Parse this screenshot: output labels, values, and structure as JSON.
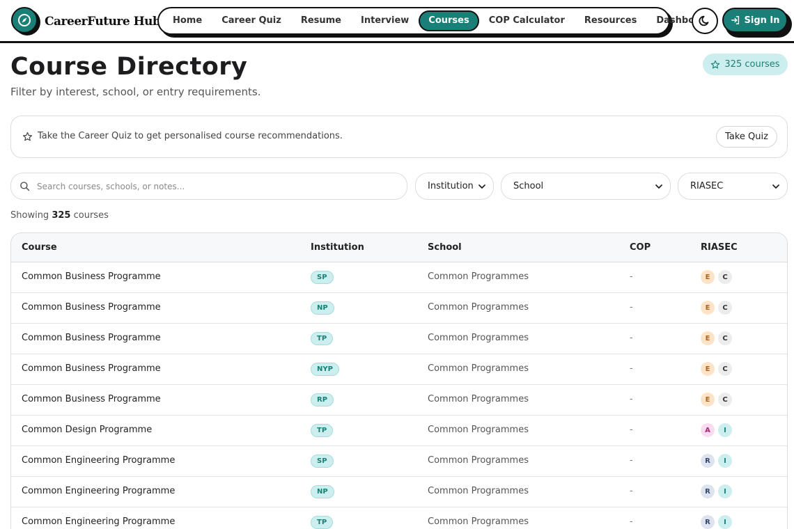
{
  "brand": {
    "name": "CareerFuture Hub"
  },
  "nav": {
    "items": [
      {
        "label": "Home"
      },
      {
        "label": "Career Quiz"
      },
      {
        "label": "Resume"
      },
      {
        "label": "Interview"
      },
      {
        "label": "Courses",
        "active": true
      },
      {
        "label": "COP Calculator"
      },
      {
        "label": "Resources"
      },
      {
        "label": "Dashboard"
      }
    ],
    "sign_in_label": "Sign In"
  },
  "page": {
    "title": "Course Directory",
    "subtitle": "Filter by interest, school, or entry requirements.",
    "course_count_badge": "325 courses"
  },
  "banner": {
    "text": "Take the Career Quiz to get personalised course recommendations.",
    "button_label": "Take Quiz"
  },
  "filters": {
    "search_placeholder": "Search courses, schools, or notes...",
    "institution": "Institution",
    "school": "School",
    "riasec": "RIASEC"
  },
  "results": {
    "showing_prefix": "Showing",
    "count": "325",
    "suffix": "courses"
  },
  "table": {
    "headers": {
      "course": "Course",
      "institution": "Institution",
      "school": "School",
      "cop": "COP",
      "riasec": "RIASEC"
    },
    "rows": [
      {
        "course": "Common Business Programme",
        "institution": "SP",
        "school": "Common Programmes",
        "cop": "-",
        "riasec": [
          "E",
          "C"
        ]
      },
      {
        "course": "Common Business Programme",
        "institution": "NP",
        "school": "Common Programmes",
        "cop": "-",
        "riasec": [
          "E",
          "C"
        ]
      },
      {
        "course": "Common Business Programme",
        "institution": "TP",
        "school": "Common Programmes",
        "cop": "-",
        "riasec": [
          "E",
          "C"
        ]
      },
      {
        "course": "Common Business Programme",
        "institution": "NYP",
        "school": "Common Programmes",
        "cop": "-",
        "riasec": [
          "E",
          "C"
        ]
      },
      {
        "course": "Common Business Programme",
        "institution": "RP",
        "school": "Common Programmes",
        "cop": "-",
        "riasec": [
          "E",
          "C"
        ]
      },
      {
        "course": "Common Design Programme",
        "institution": "TP",
        "school": "Common Programmes",
        "cop": "-",
        "riasec": [
          "A",
          "I"
        ]
      },
      {
        "course": "Common Engineering Programme",
        "institution": "SP",
        "school": "Common Programmes",
        "cop": "-",
        "riasec": [
          "R",
          "I"
        ]
      },
      {
        "course": "Common Engineering Programme",
        "institution": "NP",
        "school": "Common Programmes",
        "cop": "-",
        "riasec": [
          "R",
          "I"
        ]
      },
      {
        "course": "Common Engineering Programme",
        "institution": "TP",
        "school": "Common Programmes",
        "cop": "-",
        "riasec": [
          "R",
          "I"
        ]
      }
    ]
  },
  "colors": {
    "accent": "#1a7f76",
    "accent_light": "#cdeeee",
    "ink": "#111111"
  },
  "icons": {
    "logo": "compass-icon",
    "theme": "moon-icon",
    "sign_in": "login-icon",
    "banner": "star-icon",
    "search": "search-icon",
    "dropdown": "chevron-down-icon"
  }
}
